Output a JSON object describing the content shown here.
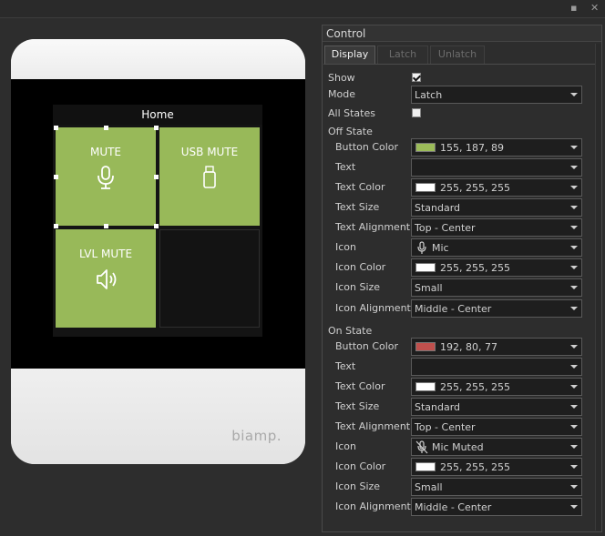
{
  "device": {
    "page_title": "Home",
    "brand": "biamp.",
    "tiles": [
      {
        "label": "MUTE",
        "icon": "microphone-icon",
        "color": "#98b959"
      },
      {
        "label": "USB MUTE",
        "icon": "usb-drive-icon",
        "color": "#98b959"
      },
      {
        "label": "LVL MUTE",
        "icon": "speaker-icon",
        "color": "#98b959"
      },
      {
        "label": "",
        "icon": "",
        "color": "#131313"
      }
    ]
  },
  "panel": {
    "title": "Control",
    "tabs": [
      "Display",
      "Latch",
      "Unlatch"
    ],
    "active_tab": "Display",
    "show_label": "Show",
    "show_checked": true,
    "mode_label": "Mode",
    "mode_value": "Latch",
    "all_states_label": "All States",
    "all_states_checked": false,
    "off_state": {
      "heading": "Off State",
      "button_color_label": "Button Color",
      "button_color_value": "155, 187, 89",
      "button_color_hex": "#9bbb59",
      "text_label": "Text",
      "text_value": "",
      "text_color_label": "Text Color",
      "text_color_value": "255, 255, 255",
      "text_color_hex": "#ffffff",
      "text_size_label": "Text Size",
      "text_size_value": "Standard",
      "text_alignment_label": "Text Alignment",
      "text_alignment_value": "Top - Center",
      "icon_label": "Icon",
      "icon_value": "Mic",
      "icon_name": "microphone-icon",
      "icon_color_label": "Icon Color",
      "icon_color_value": "255, 255, 255",
      "icon_color_hex": "#ffffff",
      "icon_size_label": "Icon Size",
      "icon_size_value": "Small",
      "icon_alignment_label": "Icon Alignment",
      "icon_alignment_value": "Middle - Center"
    },
    "on_state": {
      "heading": "On State",
      "button_color_label": "Button Color",
      "button_color_value": "192, 80, 77",
      "button_color_hex": "#c0504d",
      "text_label": "Text",
      "text_value": "",
      "text_color_label": "Text Color",
      "text_color_value": "255, 255, 255",
      "text_color_hex": "#ffffff",
      "text_size_label": "Text Size",
      "text_size_value": "Standard",
      "text_alignment_label": "Text Alignment",
      "text_alignment_value": "Top - Center",
      "icon_label": "Icon",
      "icon_value": "Mic Muted",
      "icon_name": "microphone-muted-icon",
      "icon_color_label": "Icon Color",
      "icon_color_value": "255, 255, 255",
      "icon_color_hex": "#ffffff",
      "icon_size_label": "Icon Size",
      "icon_size_value": "Small",
      "icon_alignment_label": "Icon Alignment",
      "icon_alignment_value": "Middle - Center"
    }
  },
  "window": {
    "pin_icon": "pin-icon",
    "close_icon": "close-icon"
  }
}
